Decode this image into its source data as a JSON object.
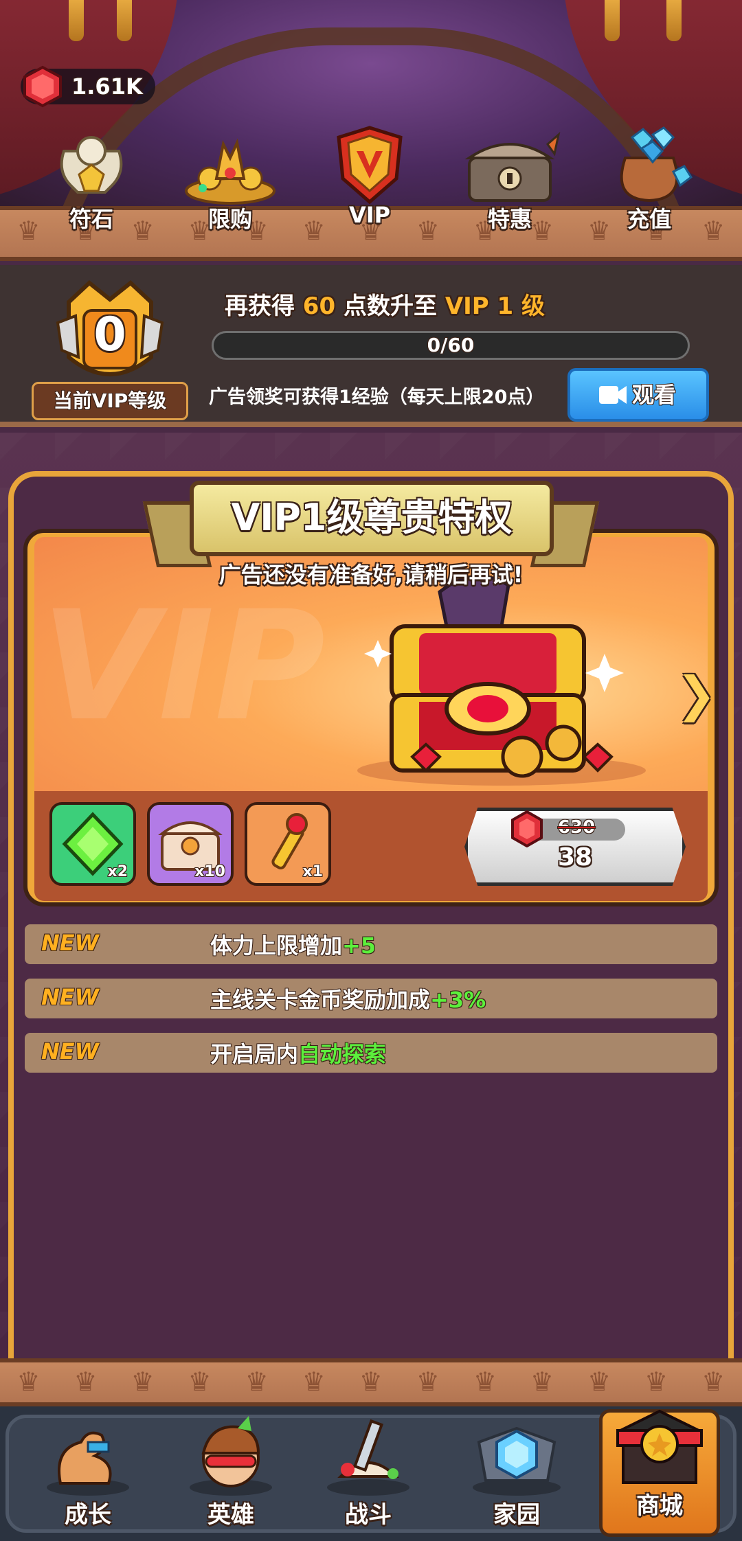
{
  "currency": {
    "gems": "1.61K",
    "icon": "red-gem-icon"
  },
  "top_tabs": [
    {
      "label": "符石",
      "icon": "rune-statue-icon"
    },
    {
      "label": "限购",
      "icon": "treasure-pile-icon"
    },
    {
      "label": "VIP",
      "icon": "vip-shield-icon",
      "active": true
    },
    {
      "label": "特惠",
      "icon": "offer-chest-icon"
    },
    {
      "label": "充值",
      "icon": "gem-sack-icon"
    }
  ],
  "vip": {
    "current_level": "0",
    "current_level_label": "当前VIP等级",
    "upgrade_prefix": "再获得",
    "points_needed": "60",
    "upgrade_mid": "点数升至",
    "next_level": "VIP 1 级",
    "progress_text": "0/60",
    "progress_fraction": 0.0,
    "ad_hint": "广告领奖可获得1经验（每天上限20点）",
    "watch_label": "观看"
  },
  "privilege_card": {
    "title": "VIP1级尊贵特权",
    "ad_message": "广告还没有准备好,请稍后再试!",
    "watermark": "VIP",
    "items": [
      {
        "icon": "green-gem-icon",
        "count": "x2",
        "color": "#3ccf7a"
      },
      {
        "icon": "purple-chest-icon",
        "count": "x10",
        "color": "#b27be6"
      },
      {
        "icon": "golden-key-icon",
        "count": "x1",
        "color": "#f39a55"
      }
    ],
    "price": {
      "original": "630",
      "current": "38",
      "icon": "red-gem-icon"
    }
  },
  "perks": [
    {
      "badge": "NEW",
      "text": "体力上限增加",
      "highlight": "+5"
    },
    {
      "badge": "NEW",
      "text": "主线关卡金币奖励加成",
      "highlight": "+3%"
    },
    {
      "badge": "NEW",
      "text": "开启局内",
      "highlight": "自动探索"
    }
  ],
  "bottom_nav": [
    {
      "label": "成长",
      "icon": "muscle-arm-icon"
    },
    {
      "label": "英雄",
      "icon": "hero-face-icon"
    },
    {
      "label": "战斗",
      "icon": "sword-icon"
    },
    {
      "label": "家园",
      "icon": "home-crystal-icon"
    },
    {
      "label": "商城",
      "icon": "shop-stall-icon",
      "active": true
    }
  ],
  "colors": {
    "accent_gold": "#ffb52b",
    "perk_green": "#5cf03c",
    "watch_blue": "#2a8ee8",
    "panel_border": "#e8a53a"
  }
}
